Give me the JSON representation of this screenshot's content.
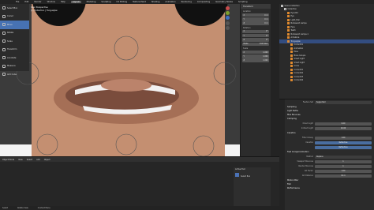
{
  "menu": [
    "File",
    "Edit",
    "Render",
    "Window",
    "Help",
    "Layout",
    "Modeling",
    "Sculpting",
    "UV Editing",
    "Texture Paint",
    "Shading",
    "Animation",
    "Rendering",
    "Compositing",
    "Geometry Nodes",
    "Scripting"
  ],
  "active_workspace": "Layout",
  "tools": [
    "Select Box",
    "Cursor",
    "Move",
    "Rotate",
    "Scale",
    "Transform",
    "Annotate",
    "Measure",
    "Add Cube"
  ],
  "selected_tool": "Move",
  "viewport": {
    "line1": "User Perspective",
    "line2": "(1) Collection | TongueJaw"
  },
  "npanel": {
    "header": "Transform",
    "rows": [
      {
        "k": "Location",
        "v": ""
      },
      {
        "k": "X",
        "v": "0 m"
      },
      {
        "k": "Y",
        "v": "0 m"
      },
      {
        "k": "Z",
        "v": "0 m"
      },
      {
        "k": "Rotation",
        "v": ""
      },
      {
        "k": "X",
        "v": "0°"
      },
      {
        "k": "Y",
        "v": "0°"
      },
      {
        "k": "Z",
        "v": "0°"
      },
      {
        "k": "Mode",
        "v": "XYZ Euler"
      },
      {
        "k": "Scale",
        "v": ""
      },
      {
        "k": "X",
        "v": "1.000"
      },
      {
        "k": "Y",
        "v": "1.000"
      },
      {
        "k": "Z",
        "v": "1.000"
      }
    ]
  },
  "outliner": [
    {
      "t": "Scene Collection",
      "d": 0
    },
    {
      "t": "Collection",
      "d": 1
    },
    {
      "t": "Eye.001",
      "d": 2
    },
    {
      "t": "Eye",
      "d": 2
    },
    {
      "t": "Light_Hair",
      "d": 2
    },
    {
      "t": "Nodeward Lampe",
      "d": 2
    },
    {
      "t": "Face",
      "d": 2
    },
    {
      "t": "Teeth",
      "d": 2
    },
    {
      "t": "Nodeward Lampe.1",
      "d": 2
    },
    {
      "t": "Armature",
      "d": 2
    },
    {
      "t": "TongueJaw",
      "d": 2,
      "sel": true
    },
    {
      "t": "Circle.001",
      "d": 3
    },
    {
      "t": "Animation",
      "d": 3
    },
    {
      "t": "Pose",
      "d": 3
    },
    {
      "t": "Bone Groups",
      "d": 3
    },
    {
      "t": "Smart Light",
      "d": 3
    },
    {
      "t": "Smart Light",
      "d": 3
    },
    {
      "t": "Circle",
      "d": 3
    },
    {
      "t": "Circle.001",
      "d": 3
    },
    {
      "t": "Circle.002",
      "d": 3
    },
    {
      "t": "Circle.003",
      "d": 3
    },
    {
      "t": "Circle.004",
      "d": 3
    }
  ],
  "props": {
    "feature_set": "Supported",
    "sections": [
      "Sampling",
      "Light Paths",
      "Max Bounces",
      "Clamping",
      "Caustics",
      "Fast GI Approximation",
      "Motion Blur",
      "Film",
      "Performance"
    ],
    "fields": [
      {
        "k": "Feature Set",
        "v": "Supported"
      },
      {
        "k": "Direct Light",
        "v": "0.00"
      },
      {
        "k": "Indirect Light",
        "v": "10.00"
      },
      {
        "k": "Filter Glossy",
        "v": "1.00"
      },
      {
        "k": "Caustics",
        "v": "Reflective"
      },
      {
        "k": "",
        "v": "Refractive"
      },
      {
        "k": "Method",
        "v": "Replace"
      },
      {
        "k": "Viewport Bounces",
        "v": "1"
      },
      {
        "k": "Render Bounces",
        "v": "1"
      },
      {
        "k": "AO Factor",
        "v": "1.00"
      },
      {
        "k": "AO Distance",
        "v": "10 m"
      }
    ]
  },
  "timeline": {
    "items": [
      "Object Mode",
      "View",
      "Select",
      "Add",
      "Object"
    ]
  },
  "asset": {
    "title": "Active Tool",
    "items": [
      "Select Box"
    ]
  },
  "status": [
    "Select",
    "Rotate View",
    "Context Menu"
  ]
}
